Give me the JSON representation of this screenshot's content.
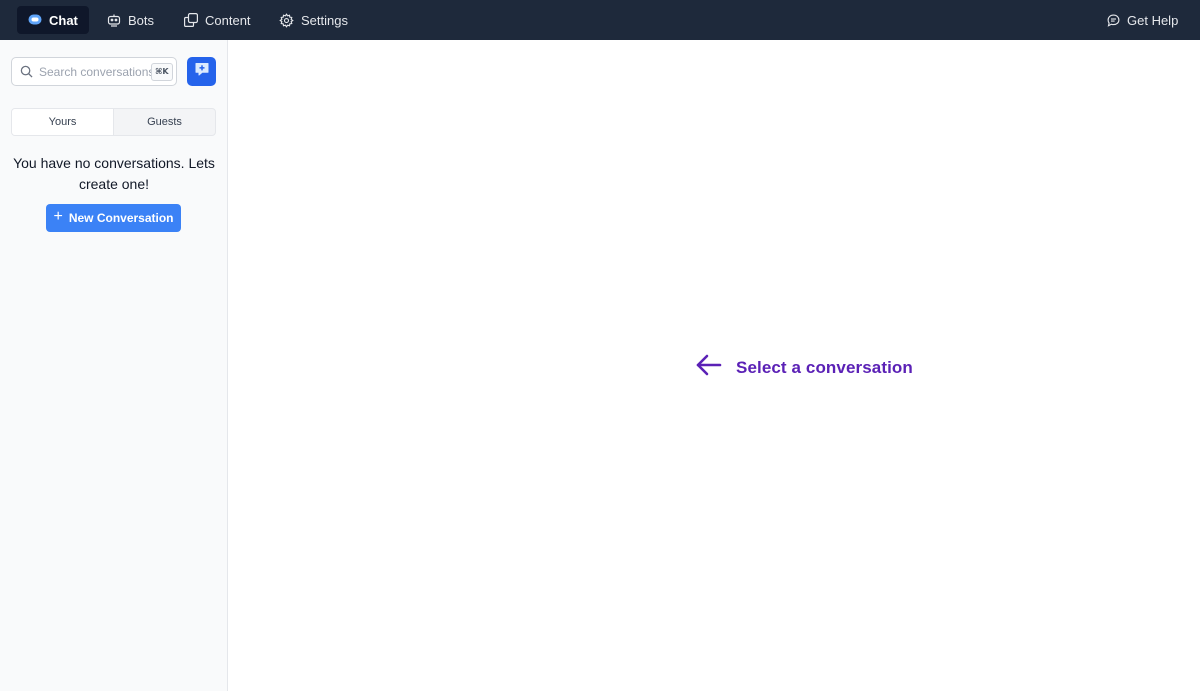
{
  "nav": {
    "chat": "Chat",
    "bots": "Bots",
    "content": "Content",
    "settings": "Settings",
    "help": "Get Help"
  },
  "sidebar": {
    "search_placeholder": "Search conversations...",
    "shortcut": "⌘K",
    "tabs": [
      "Yours",
      "Guests"
    ],
    "empty_message": "You have no conversations. Lets create one!",
    "new_conversation_label": "New Conversation",
    "new_conversation_icon": "+"
  },
  "main": {
    "hint": "Select a conversation"
  },
  "colors": {
    "topbar": "#1e293b",
    "accent": "#2563eb",
    "button": "#3b82f6",
    "hint": "#5b21b6"
  }
}
